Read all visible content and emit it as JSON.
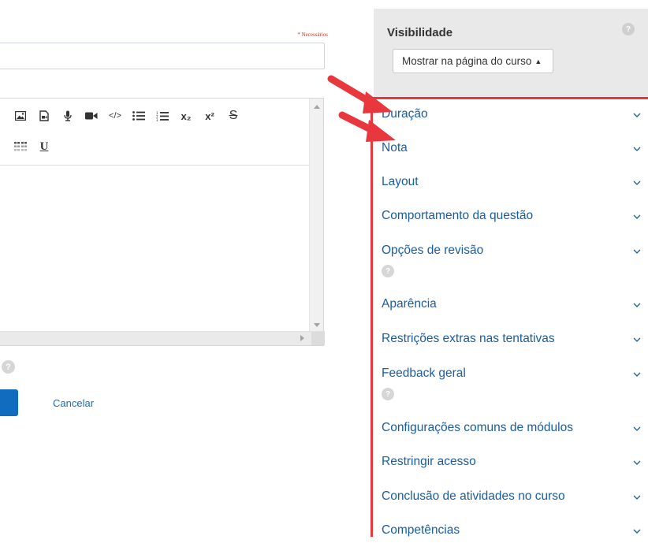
{
  "form": {
    "required_label": "* Necessários",
    "cancel_label": "Cancelar",
    "help_glyph": "?"
  },
  "editor": {
    "toolbar_row1": [
      {
        "icon": "image-icon"
      },
      {
        "icon": "media-file-icon"
      },
      {
        "icon": "microphone-icon"
      },
      {
        "icon": "video-camera-icon"
      },
      {
        "icon": "code-icon",
        "glyph": "</>"
      },
      {
        "icon": "unordered-list-icon"
      },
      {
        "icon": "ordered-list-icon"
      },
      {
        "icon": "subscript-icon",
        "glyph": "x₂"
      },
      {
        "icon": "superscript-icon",
        "glyph": "x²"
      },
      {
        "icon": "strikethrough-icon",
        "glyph": "S"
      }
    ],
    "toolbar_row2": [
      {
        "icon": "table-icon"
      },
      {
        "icon": "underline-icon",
        "glyph": "U"
      }
    ]
  },
  "visibility": {
    "title": "Visibilidade",
    "select_value": "Mostrar na página do curso",
    "help_glyph": "?"
  },
  "sections": [
    {
      "label": "Duração",
      "has_help": false
    },
    {
      "label": "Nota",
      "has_help": false
    },
    {
      "label": "Layout",
      "has_help": false
    },
    {
      "label": "Comportamento da questão",
      "has_help": false
    },
    {
      "label": "Opções de revisão",
      "has_help": true
    },
    {
      "label": "Aparência",
      "has_help": false
    },
    {
      "label": "Restrições extras nas tentativas",
      "has_help": false
    },
    {
      "label": "Feedback geral",
      "has_help": true
    },
    {
      "label": "Configurações comuns de módulos",
      "has_help": false
    },
    {
      "label": "Restringir acesso",
      "has_help": false
    },
    {
      "label": "Conclusão de atividades no curso",
      "has_help": false
    },
    {
      "label": "Competências",
      "has_help": false
    }
  ],
  "colors": {
    "link": "#1a5ca0",
    "annotation_red": "#e8383d",
    "primary_button": "#0f6cbf",
    "panel_bg": "#e9e9e9"
  }
}
